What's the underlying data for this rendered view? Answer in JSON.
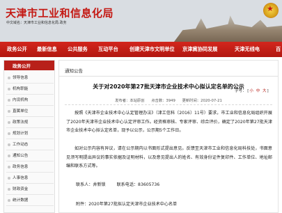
{
  "header": {
    "site_title": "天津市工业和信息化局",
    "site_subtitle": "中文域名：天津市工业和信息化局.政务"
  },
  "nav": {
    "items": [
      "政务公开",
      "最新信息",
      "公共服务",
      "互动平台",
      "创建天津市文明单位",
      "京津冀协同发展",
      "天津无线电",
      "百"
    ]
  },
  "sidebar": {
    "heading": "政务公开",
    "items": [
      "领导信息",
      "机构职能",
      "内设机构",
      "直属单位",
      "政策法规",
      "规划计划",
      "工作动态",
      "通知公告",
      "政务信息",
      "人事信息",
      "财政资金",
      "统计数据"
    ]
  },
  "content": {
    "breadcrumb": "通知公告",
    "title": "关于对2020年第27批天津市企业技术中心拟认定名单的公示",
    "font_size_label": "字号：",
    "font_sizes": [
      "小",
      "中",
      "大"
    ],
    "meta": {
      "source": "发布者：",
      "site": "本站原创",
      "views": "点击数：3949",
      "date_label": "更新时间：",
      "date": "2020-07-21"
    },
    "paragraphs": [
      "按照《天津市企业技术中心认定管理办法》（津工信科〔2016〕11号）要求，市工业和信息化局组织开展了2020年天津市企业技术中心认定评审工作。经资格审核、专家评审、综合评价，确定了2020年第27批天津市企业技术中心拟认定名单，现予以公示，公示期5个工作日。",
      "如对公示内容有异议，请在公示期内以书面形式提出意见。反馈至天津市工业和信息化局科技处，书面意见须写明提出异议的事实依据及证明材料，以及意见提出人的姓名、有效身份证件复印件、工作单位、地址邮编和联系方式等。"
    ],
    "contact": {
      "person": "联系人：井新锁",
      "phone": "联系电话：83605736"
    },
    "attachment": "附件：2020年第27批拟认定天津市企业技术中心名单"
  }
}
